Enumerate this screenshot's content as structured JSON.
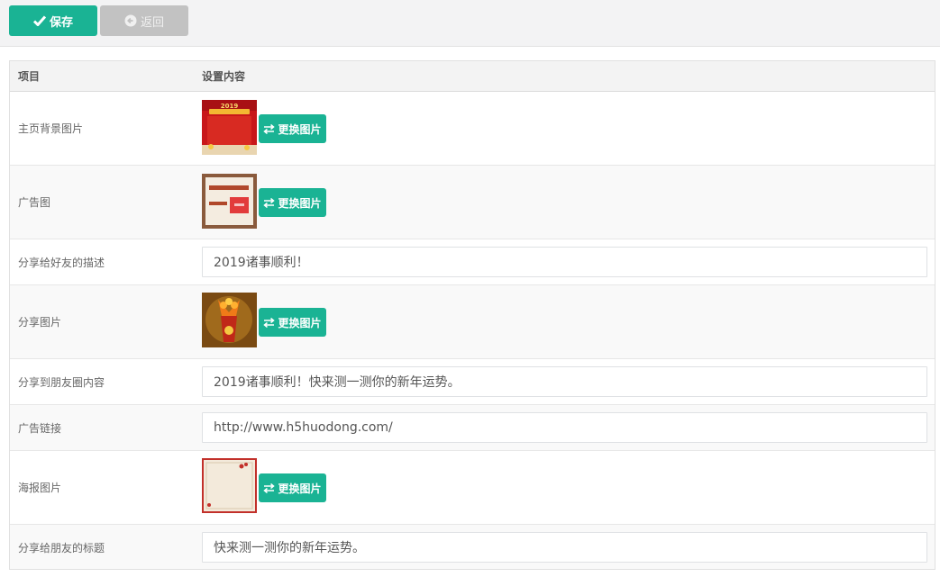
{
  "toolbar": {
    "save_label": "保存",
    "back_label": "返回",
    "save_color": "#1ab394",
    "back_color": "#c2c2c2"
  },
  "table": {
    "headers": [
      "项目",
      "设置内容"
    ],
    "rows": [
      {
        "label": "主页背景图片",
        "type": "image",
        "button": "更换图片",
        "thumb": "red-new-year-background",
        "thumb_text": "2019 猪年吉祥"
      },
      {
        "label": "广告图",
        "type": "image",
        "button": "更换图片",
        "thumb": "ad-banner-image"
      },
      {
        "label": "分享给好友的描述",
        "type": "text",
        "value": "2019诸事顺利！"
      },
      {
        "label": "分享图片",
        "type": "image",
        "button": "更换图片",
        "thumb": "lantern-vase-image"
      },
      {
        "label": "分享到朋友圈内容",
        "type": "text",
        "value": "2019诸事顺利！快来测一测你的新年运势。"
      },
      {
        "label": "广告链接",
        "type": "text",
        "value": "http://www.h5huodong.com/"
      },
      {
        "label": "海报图片",
        "type": "image",
        "button": "更换图片",
        "thumb": "poster-frame-image"
      },
      {
        "label": "分享给朋友的标题",
        "type": "text",
        "value": "快来测一测你的新年运势。"
      }
    ]
  }
}
